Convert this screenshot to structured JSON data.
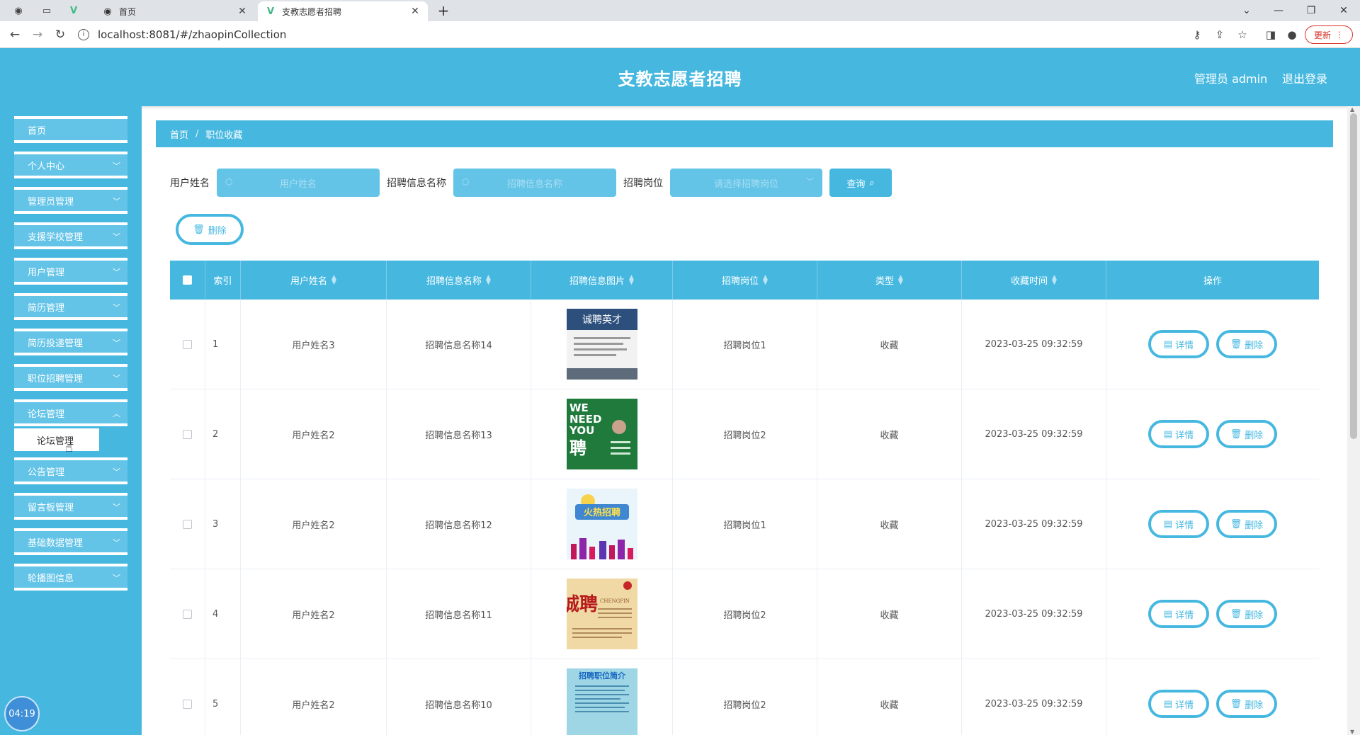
{
  "browser": {
    "tabs": [
      {
        "title": "首页",
        "active": false
      },
      {
        "title": "支教志愿者招聘",
        "active": true
      }
    ],
    "url": "localhost:8081/#/zhaopinCollection",
    "update_label": "更新"
  },
  "header": {
    "title": "支教志愿者招聘",
    "user": "管理员 admin",
    "logout": "退出登录"
  },
  "sidebar": {
    "items": [
      {
        "label": "首页"
      },
      {
        "label": "个人中心"
      },
      {
        "label": "管理员管理"
      },
      {
        "label": "支援学校管理"
      },
      {
        "label": "用户管理"
      },
      {
        "label": "简历管理"
      },
      {
        "label": "简历投递管理"
      },
      {
        "label": "职位招聘管理"
      },
      {
        "label": "论坛管理"
      },
      {
        "label": "公告管理"
      },
      {
        "label": "留言板管理"
      },
      {
        "label": "基础数据管理"
      },
      {
        "label": "轮播图信息"
      }
    ],
    "submenu_label": "论坛管理",
    "clock": "04:19"
  },
  "breadcrumb": {
    "home": "首页",
    "sep": "/",
    "current": "职位收藏"
  },
  "search": {
    "user_label": "用户姓名",
    "user_placeholder": "用户姓名",
    "zp_label": "招聘信息名称",
    "zp_placeholder": "招聘信息名称",
    "gw_label": "招聘岗位",
    "gw_placeholder": "请选择招聘岗位",
    "query_label": "查询"
  },
  "batch_delete_label": "删除",
  "table": {
    "headers": {
      "idx": "索引",
      "name": "用户姓名",
      "zp": "招聘信息名称",
      "img": "招聘信息图片",
      "gw": "招聘岗位",
      "type": "类型",
      "time": "收藏时间",
      "op": "操作"
    },
    "detail_label": "详情",
    "delete_label": "删除",
    "rows": [
      {
        "idx": "1",
        "name": "用户姓名3",
        "zp": "招聘信息名称14",
        "gw": "招聘岗位1",
        "type": "收藏",
        "time": "2023-03-25 09:32:59"
      },
      {
        "idx": "2",
        "name": "用户姓名2",
        "zp": "招聘信息名称13",
        "gw": "招聘岗位2",
        "type": "收藏",
        "time": "2023-03-25 09:32:59"
      },
      {
        "idx": "3",
        "name": "用户姓名2",
        "zp": "招聘信息名称12",
        "gw": "招聘岗位1",
        "type": "收藏",
        "time": "2023-03-25 09:32:59"
      },
      {
        "idx": "4",
        "name": "用户姓名2",
        "zp": "招聘信息名称11",
        "gw": "招聘岗位2",
        "type": "收藏",
        "time": "2023-03-25 09:32:59"
      },
      {
        "idx": "5",
        "name": "用户姓名2",
        "zp": "招聘信息名称10",
        "gw": "招聘岗位2",
        "type": "收藏",
        "time": "2023-03-25 09:32:59"
      }
    ],
    "poster_text": {
      "p1": "诚聘英才",
      "p2_line1": "WE",
      "p2_line2": "NEED",
      "p2_line3": "YOU",
      "p2_line4": "聘",
      "p3": "火热招聘",
      "p4": "诚聘",
      "p4_en": "CHENGPIN",
      "p5": "招聘职位简介"
    }
  },
  "colors": {
    "primary": "#46b8e0",
    "primary_light": "#64c4e8"
  }
}
